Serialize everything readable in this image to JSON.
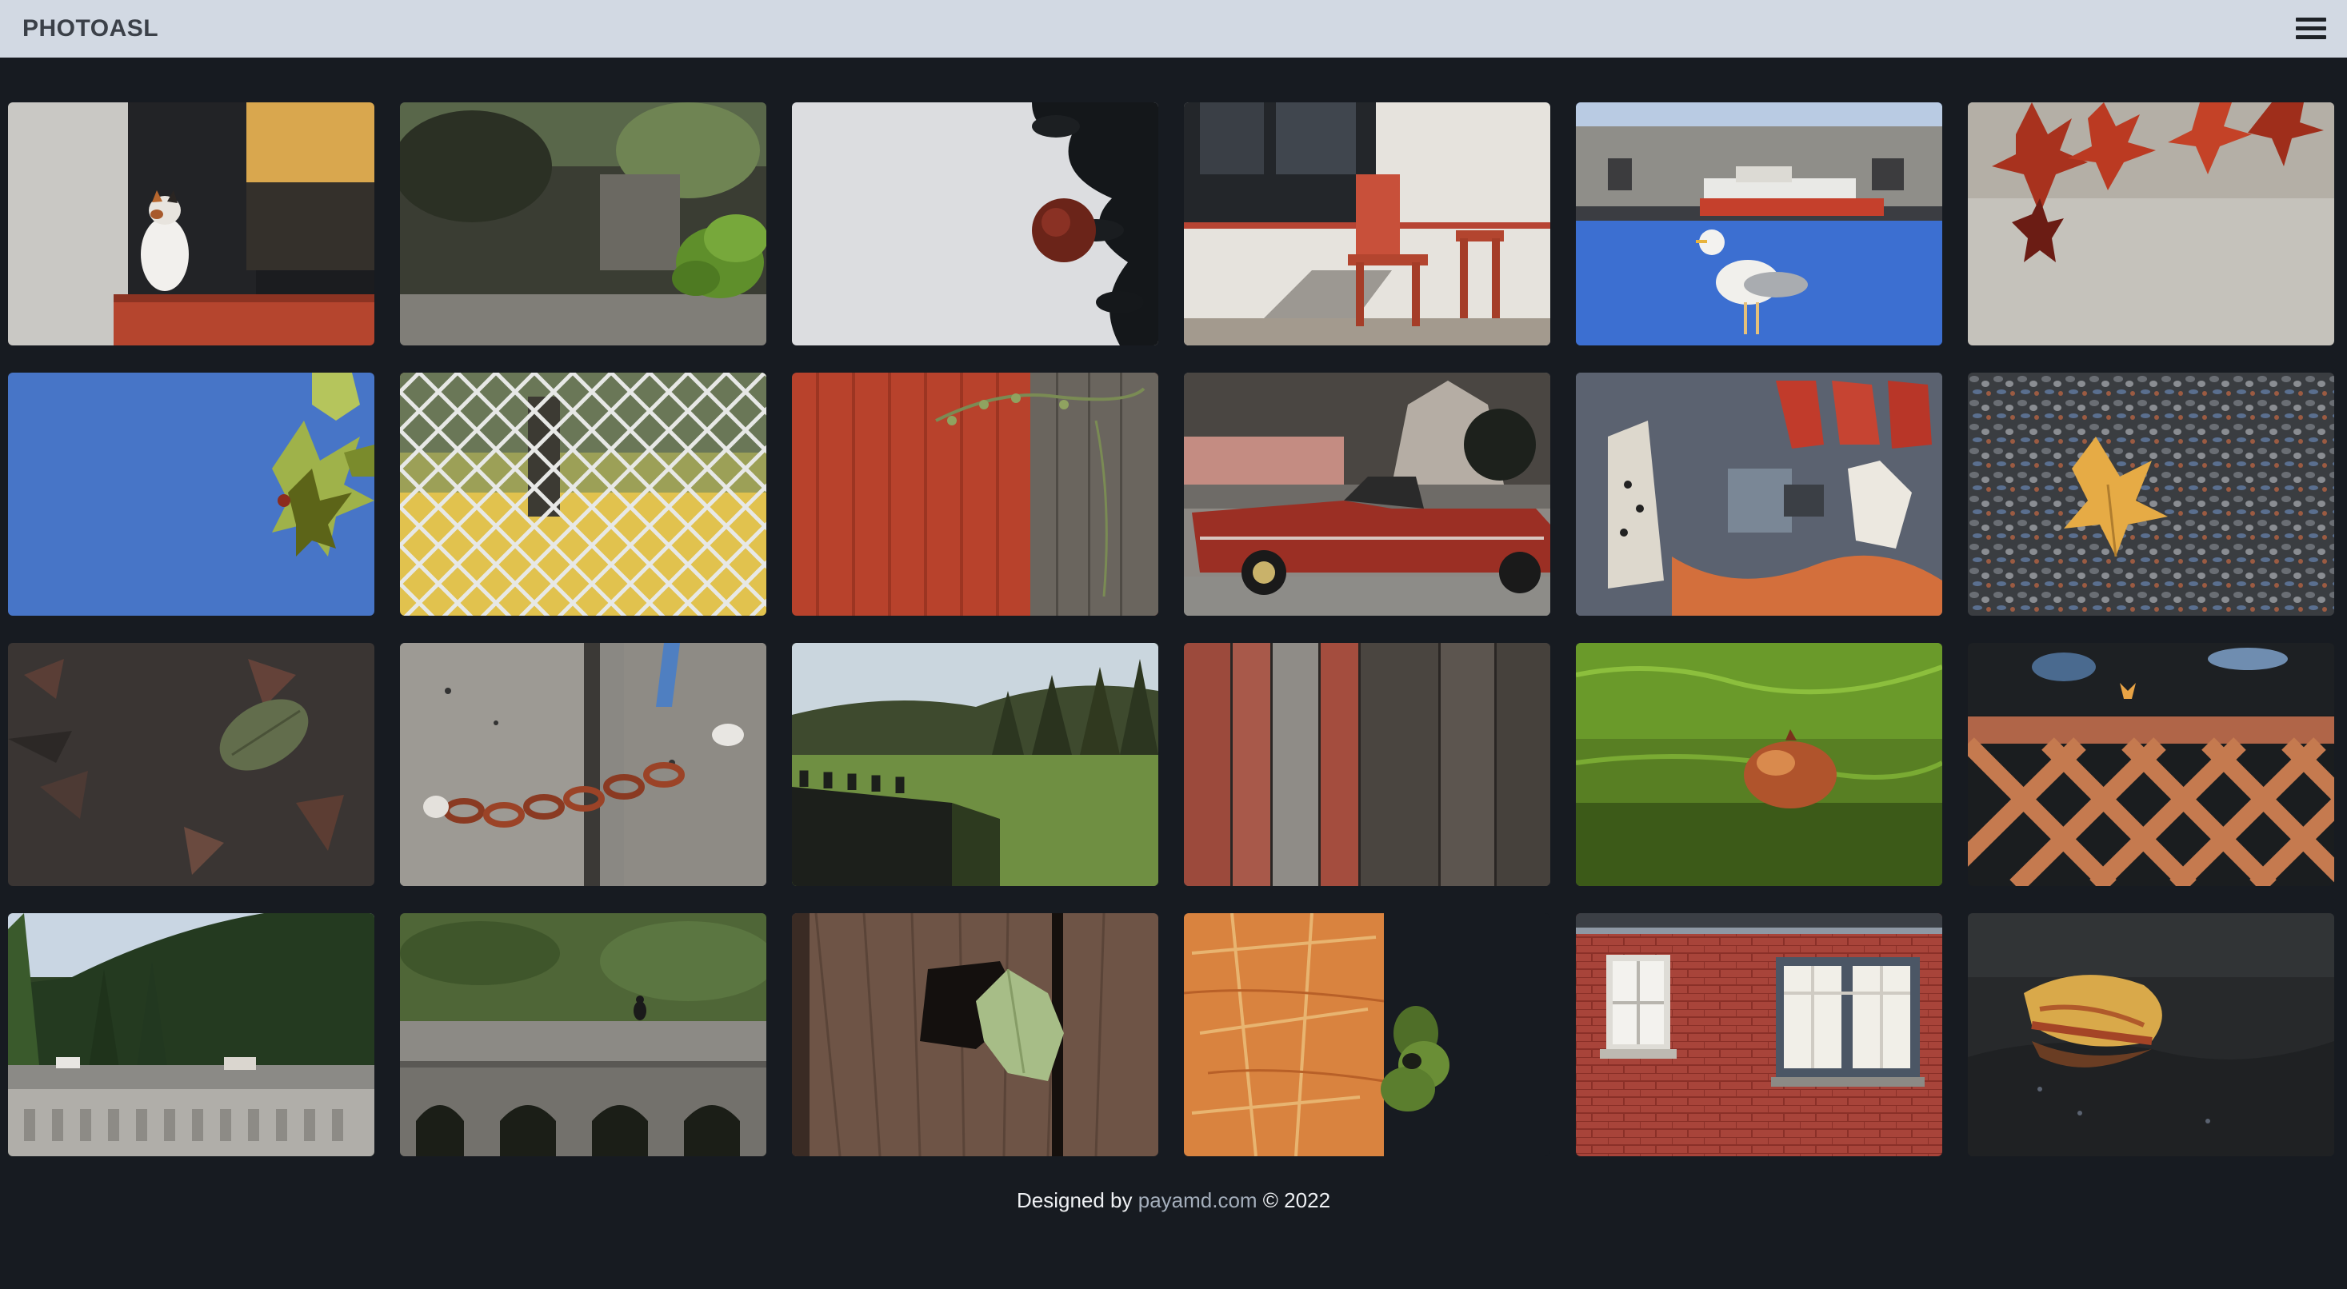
{
  "navbar": {
    "brand": "PHOTOASL",
    "menu_icon": "hamburger-menu-icon"
  },
  "gallery": {
    "photos": [
      {
        "name": "photo-calico-cat"
      },
      {
        "name": "photo-green-leaves-blurred-house"
      },
      {
        "name": "photo-orange-on-branch"
      },
      {
        "name": "photo-red-adirondack-chairs"
      },
      {
        "name": "photo-seagull-harbor"
      },
      {
        "name": "photo-red-maple-leaves"
      },
      {
        "name": "photo-leaves-blue-sky"
      },
      {
        "name": "photo-chain-link-fence"
      },
      {
        "name": "photo-red-wall-vine"
      },
      {
        "name": "photo-red-convertible-car"
      },
      {
        "name": "photo-graffiti-wall"
      },
      {
        "name": "photo-leaf-on-gravel"
      },
      {
        "name": "photo-leaf-on-ground"
      },
      {
        "name": "photo-rusty-chain-post"
      },
      {
        "name": "photo-forest-hillside"
      },
      {
        "name": "photo-wooden-planks"
      },
      {
        "name": "photo-pomegranate-grass"
      },
      {
        "name": "photo-lattice-fence"
      },
      {
        "name": "photo-forest-bridge"
      },
      {
        "name": "photo-bird-on-bridge"
      },
      {
        "name": "photo-ivy-leaf-wood"
      },
      {
        "name": "photo-orange-wall-green-fruit"
      },
      {
        "name": "photo-brick-house-windows"
      },
      {
        "name": "photo-leaf-on-wet-pavement"
      }
    ]
  },
  "footer": {
    "prefix": "Designed by ",
    "link_text": "payamd.com",
    "suffix": " © 2022"
  },
  "colors": {
    "page_background": "#171b21",
    "navbar_background": "#d2d9e3",
    "brand_text": "#3b4048",
    "footer_text": "#eef0f3",
    "footer_link": "#a4aebb"
  }
}
